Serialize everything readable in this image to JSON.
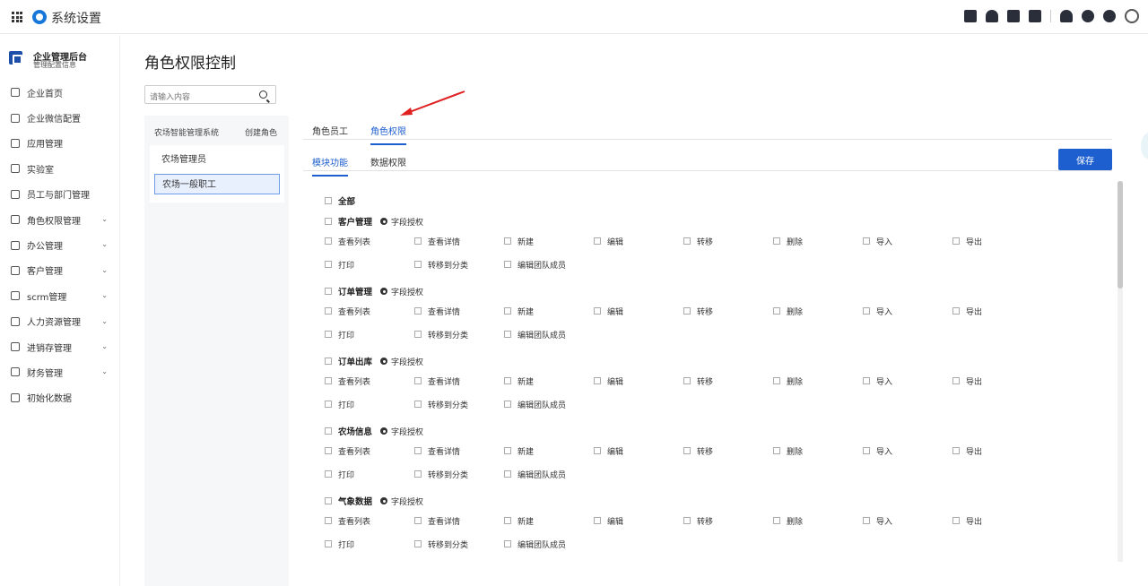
{
  "header": {
    "app_title": "系统设置",
    "icons": [
      "grid-icon",
      "app-logo-icon",
      "calendar-check-icon",
      "user-icon",
      "document-icon",
      "phone-icon",
      "bell-icon",
      "help-icon",
      "gear-icon",
      "account-icon"
    ]
  },
  "sidebar": {
    "org_name": "企业管理后台",
    "org_sub": "管理配置信息",
    "items": [
      {
        "label": "企业首页",
        "icon": "home-icon",
        "expandable": false
      },
      {
        "label": "企业微信配置",
        "icon": "chat-icon",
        "expandable": false
      },
      {
        "label": "应用管理",
        "icon": "apps-icon",
        "expandable": false
      },
      {
        "label": "实验室",
        "icon": "bulb-icon",
        "expandable": false
      },
      {
        "label": "员工与部门管理",
        "icon": "people-icon",
        "expandable": false
      },
      {
        "label": "角色权限管理",
        "icon": "role-icon",
        "expandable": true
      },
      {
        "label": "办公管理",
        "icon": "office-icon",
        "expandable": true
      },
      {
        "label": "客户管理",
        "icon": "customer-icon",
        "expandable": true
      },
      {
        "label": "scrm管理",
        "icon": "scrm-icon",
        "expandable": true
      },
      {
        "label": "人力资源管理",
        "icon": "hr-icon",
        "expandable": true
      },
      {
        "label": "进销存管理",
        "icon": "inventory-icon",
        "expandable": true
      },
      {
        "label": "财务管理",
        "icon": "finance-icon",
        "expandable": true
      },
      {
        "label": "初始化数据",
        "icon": "init-icon",
        "expandable": false
      }
    ]
  },
  "main": {
    "title": "角色权限控制",
    "search_placeholder": "请输入内容",
    "role_group": "农场智能管理系统",
    "create_role": "创建角色",
    "roles": [
      "农场管理员",
      "农场一般职工"
    ],
    "active_role": "农场一般职工",
    "tabs": [
      "角色员工",
      "角色权限"
    ],
    "active_tab": "角色权限",
    "subtabs": [
      "模块功能",
      "数据权限"
    ],
    "active_subtab": "模块功能",
    "save_label": "保存",
    "all_label": "全部",
    "field_auth_label": "字段授权",
    "modules": [
      {
        "name": "客户管理"
      },
      {
        "name": "订单管理"
      },
      {
        "name": "订单出库"
      },
      {
        "name": "农场信息"
      },
      {
        "name": "气象数据"
      }
    ],
    "permissions_row1": [
      "查看列表",
      "查看详情",
      "新建",
      "编辑",
      "转移",
      "删除",
      "导入",
      "导出"
    ],
    "permissions_row2": [
      "打印",
      "转移到分类",
      "编辑团队成员"
    ]
  }
}
